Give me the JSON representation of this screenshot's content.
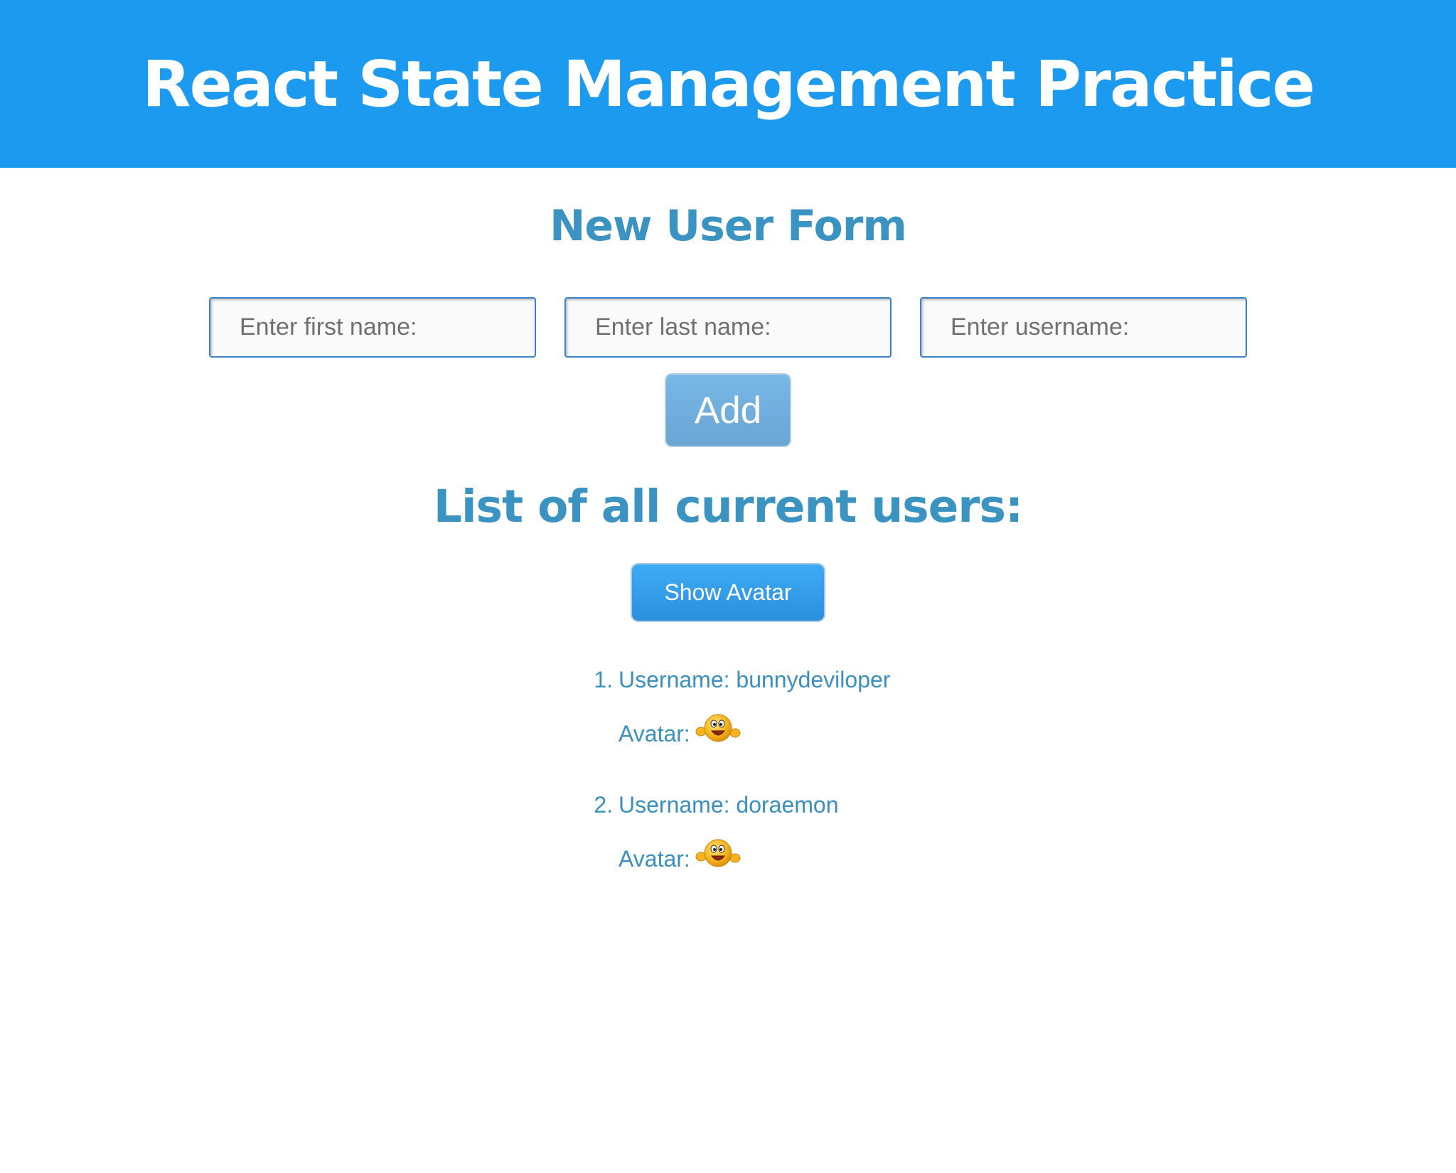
{
  "header": {
    "title": "React State Management Practice"
  },
  "form": {
    "heading": "New User Form",
    "first_name_placeholder": "Enter first name:",
    "last_name_placeholder": "Enter last name:",
    "username_placeholder": "Enter username:",
    "add_label": "Add"
  },
  "list": {
    "heading": "List of all current users:",
    "show_avatar_label": "Show Avatar",
    "username_prefix": "Username:",
    "avatar_prefix": "Avatar:",
    "avatar_icon": "waving-smiley-icon",
    "users": [
      {
        "number": "1.",
        "username": "bunnydeviloper"
      },
      {
        "number": "2.",
        "username": "doraemon"
      }
    ]
  },
  "colors": {
    "header_bg": "#1b9af0",
    "heading_text": "#3a93c0",
    "list_text": "#3a8fbe",
    "input_border": "#3b80c9",
    "add_button": "#72afdf",
    "show_avatar_button": "#2f9be9"
  }
}
